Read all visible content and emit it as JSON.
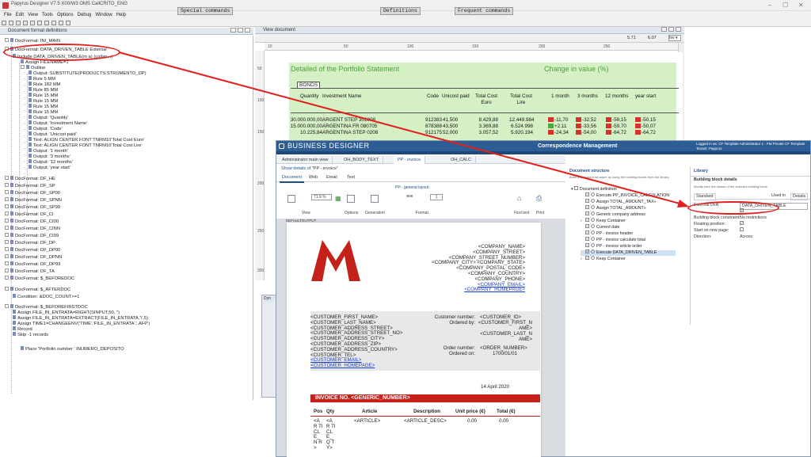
{
  "app": {
    "title": "Papyrus Designer V7.5 X00/W3 OMS CallCRITO_ENG",
    "menu": [
      "File",
      "Edit",
      "View",
      "Tools",
      "Options",
      "Debug",
      "Window",
      "Help"
    ],
    "commands": {
      "special": "Special commands",
      "definitions": "Definitions",
      "frequent": "Frequent commands"
    }
  },
  "tree": {
    "header": "Document format definitions",
    "rows": [
      {
        "t": "DocFormat: INI_MAIN",
        "l": 1,
        "tog": true
      },
      {
        "t": "DocFormat: DATA_DRIVEN_TABLE External",
        "l": 1,
        "tog": true
      },
      {
        "t": "Include DATA_DRIVEN_TABLE(m a) (collap...)",
        "l": 2
      },
      {
        "t": "Assign FILENAME=1",
        "l": 3
      },
      {
        "t": "Outline",
        "l": 3,
        "tog": true
      },
      {
        "t": "Output: SUBSTITUTE(PRODUCTS,STRUMENTO_DP)",
        "l": 4
      },
      {
        "t": "Rule 5 MM",
        "l": 4
      },
      {
        "t": "Rule 182 MM",
        "l": 4
      },
      {
        "t": "Rule 85 MM",
        "l": 4
      },
      {
        "t": "Rule 15 MM",
        "l": 4
      },
      {
        "t": "Rule 15 MM",
        "l": 4
      },
      {
        "t": "Rule 15 MM",
        "l": 4
      },
      {
        "t": "Rule 15 MM",
        "l": 4
      },
      {
        "t": "Output: 'Quantity'",
        "l": 4
      },
      {
        "t": "Output: 'Investment Name'",
        "l": 4
      },
      {
        "t": "Output: 'Code'",
        "l": 4
      },
      {
        "t": "Output: 'Unicost paid'",
        "l": 4
      },
      {
        "t": "Text: ALIGN CENTER FONT TNRM10'Total Cost Euro'",
        "l": 4
      },
      {
        "t": "Text: ALIGN CENTER FONT TNRM10'Total Cost Lire'",
        "l": 4
      },
      {
        "t": "Output: '1 month'",
        "l": 4
      },
      {
        "t": "Output: '3 months'",
        "l": 4
      },
      {
        "t": "Output: '12 months'",
        "l": 4
      },
      {
        "t": "Output: 'year start'",
        "l": 4
      },
      {
        "t": "DocFormat: DF_HE",
        "l": 1,
        "tog": true
      },
      {
        "t": "DocFormat: DF_SP",
        "l": 1,
        "tog": true
      },
      {
        "t": "DocFormat: DF_SP00",
        "l": 1,
        "tog": true
      },
      {
        "t": "DocFormat: DF_SPNN",
        "l": 1,
        "tog": true
      },
      {
        "t": "DocFormat: DF_SP99",
        "l": 1,
        "tog": true
      },
      {
        "t": "DocFormat: DF_CI",
        "l": 1,
        "tog": true
      },
      {
        "t": "DocFormat: DF_CI00",
        "l": 1,
        "tog": true
      },
      {
        "t": "DocFormat: DF_CINN",
        "l": 1,
        "tog": true
      },
      {
        "t": "DocFormat: DF_CI99",
        "l": 1,
        "tog": true
      },
      {
        "t": "DocFormat: DF_DP",
        "l": 1,
        "tog": true
      },
      {
        "t": "DocFormat: DF_DP00",
        "l": 1,
        "tog": true
      },
      {
        "t": "DocFormat: DF_DPNN",
        "l": 1,
        "tog": true
      },
      {
        "t": "DocFormat: DF_DP99",
        "l": 1,
        "tog": true
      },
      {
        "t": "DocFormat: DF_TA",
        "l": 1,
        "tog": true
      },
      {
        "t": "DocFormat: $_BEFOREDOC",
        "l": 1,
        "tog": true
      },
      {
        "t": "DocFormat: $_AFTERDOC",
        "l": 1,
        "tog": true
      },
      {
        "t": "Condition: &DOC_COUNT>=1",
        "l": 2
      },
      {
        "t": "DocFormat: $_BEFOREFIRSTDOC",
        "l": 1,
        "tog": true
      },
      {
        "t": "Assign FILE_IN_ENTRATA=RIGHT(SINPUT,50, '')",
        "l": 2
      },
      {
        "t": "Assign FILE_IN_ENTRATA=EXTRACT(FILE_IN_ENTRATA,'\\',5)",
        "l": 2
      },
      {
        "t": "Assign TIME1=CHANGEENV('TIME','FILE_IN_ENTRATA','.AFP')",
        "l": 2
      },
      {
        "t": "Record",
        "l": 2
      },
      {
        "t": "Skip -1 records",
        "l": 2
      },
      {
        "t": "Place 'Portfolio number ' INUMERO_DEPOSITO",
        "l": 3
      }
    ]
  },
  "view": {
    "header": "View document",
    "zoom": "5.71",
    "page": "6.07",
    "ruler": [
      "10",
      "50",
      "100",
      "150",
      "200",
      "250"
    ],
    "vruler": [
      "50",
      "100",
      "150",
      "200",
      "250",
      "300"
    ],
    "title1": "Detailed of the Portfolio Statement",
    "title2": "Change in value (%)",
    "bonds": "BONDS",
    "cols": [
      "Quantity",
      "Investment Name",
      "Code",
      "Unicost paid",
      "Total Cost Euro",
      "Total Cost Lire",
      "1 month",
      "3 months",
      "12 months",
      "year start"
    ],
    "rows": [
      {
        "q": "30.000.000,00",
        "n": "ARGENT STEP 301009",
        "c": "912383",
        "u": "41,500",
        "e": "8.429,88",
        "l": "12.449.984",
        "m1": "-11,70",
        "m3": "-32,52",
        "m12": "-59,15",
        "ys": "-50,15",
        "s1": "red",
        "s3": "red",
        "s12": "red",
        "sy": "red"
      },
      {
        "q": "15.000.000,00",
        "n": "ARGENTINA FR 080705",
        "c": "878388",
        "u": "43,500",
        "e": "3.369,88",
        "l": "6.524.998",
        "m1": "+2,11",
        "m3": "-33,56",
        "m12": "-59,70",
        "ys": "-50,07",
        "s1": "grn",
        "s3": "red",
        "s12": "red",
        "sy": "red"
      },
      {
        "q": "10.225,84",
        "n": "ARGENTINA STEP 0208",
        "c": "912175",
        "u": "52,000",
        "e": "3.057,52",
        "l": "5.920.194",
        "m1": "-24,34",
        "m3": "-54,00",
        "m12": "-64,72",
        "ys": "-64,72",
        "s1": "red",
        "s3": "red",
        "s12": "red",
        "sy": "red"
      }
    ]
  },
  "small_panel": {
    "header": "Dyn"
  },
  "bd": {
    "brand": "BUSINESS DESIGNER",
    "section": "Correspondence Management",
    "user": "Logged in as: CF Template Administrator 1 - FM Private CF Template",
    "tenant": "Tenant: Papyrus",
    "tabs": [
      "Administrator main view",
      "OH_BODY_TEXT",
      "PP - invoice",
      "OH_CALC"
    ],
    "show_details": "Show details of",
    "details_value": "\"PP - invoice\"",
    "subtabs": [
      "Document",
      "Web",
      "Email",
      "Text"
    ],
    "layout": "PP - general layout",
    "zoom": "71.9 %",
    "font_size": "1",
    "groups": [
      "View",
      "Options",
      "Generation",
      "Format",
      "Find text",
      "Print"
    ],
    "page_label": "DEFAULTOUTPUT",
    "invoice": {
      "company": [
        "<COMPANY_NAME>",
        "<COMPANY_STREET>",
        "<COMPANY_STREET_NUMBER>",
        "<COMPANY_CITY> <COMPANY_STATE>",
        "<COMPANY_POSTAL_CODE>",
        "<COMPANY_COUNTRY>",
        "<COMPANY_PHONE>"
      ],
      "company_links": [
        "<COMPANY_EMAIL>",
        "<COMPANY_HOMEPAGE>"
      ],
      "customer": [
        "<CUSTOMER_FIRST_NAME>",
        "<CUSTOMER_LAST_NAME>",
        "<CUSTOMER_ADDRESS_STREET>",
        "<CUSTOMER_ADDRESS_STREET_NO>",
        "<CUSTOMER_ADDRESS_CITY>",
        "<CUSTOMER_ADDRESS_ZIP>",
        "<CUSTOMER_ADDRESS_COUNTRY>",
        "<CUSTOMER_TEL>"
      ],
      "customer_links": [
        "<CUSTOMER_EMAIL>",
        "<CUSTOMER_HOMEPAGE>"
      ],
      "labels": {
        "custnum": "Customer number:",
        "orderedby": "Ordered by:",
        "ordernum": "Order number:",
        "orderedon": "Ordered on:"
      },
      "values": {
        "custid": "<CUSTOMER_ID>",
        "ob1": "<CUSTOMER_FIRST_N",
        "ob2": "AME>",
        "ob3": "<CUSTOMER_LAST_N",
        "ob4": "AME>",
        "ordnum": "<ORDER_NUMBER>",
        "orddate": "1700/01/01"
      },
      "date": "14 April 2020",
      "banner": "INVOICE NO. <GENERIC_NUMBER>",
      "cols": [
        "Pos",
        "Qty",
        "Article",
        "Description",
        "Unit price (€)",
        "Total (€)"
      ],
      "row": {
        "pos": "<AR TICL E_N R>",
        "qty": "<AR TICL E_Q TY>",
        "article": "<ARTICLE>",
        "desc": "<ARTICLE_DESC>",
        "unit": "0.00",
        "total": "0.00"
      }
    },
    "structure": {
      "title": "Document structure",
      "hint": "Build a document structure by using the building blocks from the library.",
      "root": "Document definition",
      "items": [
        "Execute PP_INVOICE_CALCULATION",
        "Assign TOTAL_AMOUNT_TAX»",
        "Assign TOTAL_AMOUNT»",
        "Generic company address",
        "Keep Container",
        "Current date",
        "PP - invoice header",
        "PP - invoice calculate total",
        "PP - invoice article order",
        "Execute DATA_DRIVEN_TABLE",
        "Keep Container"
      ]
    },
    "library": {
      "title": "Library",
      "sub": "Building block details",
      "hint": "Modify here the details of the selected building block.",
      "tabs": [
        "Standard",
        "Used in",
        "Details"
      ],
      "fields": [
        {
          "k": "External DFA:",
          "v": "DATA_DRIVEN_TABLE"
        },
        {
          "k": "",
          "v": ""
        },
        {
          "k": "Building block constraint:",
          "v": "No restrictions"
        },
        {
          "k": "Floating position:",
          "v": ""
        },
        {
          "k": "Start on new page:",
          "v": ""
        },
        {
          "k": "Direction:",
          "v": "Across"
        }
      ]
    }
  }
}
